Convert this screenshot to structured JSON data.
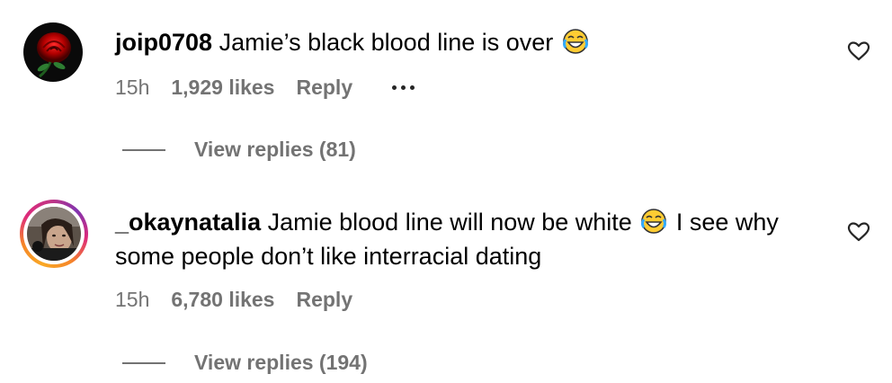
{
  "comments": [
    {
      "username": "joip0708",
      "text_before_emoji": "Jamie’s black blood line is over",
      "emoji_name": "face-with-tears-of-joy-icon",
      "text_after_emoji": "",
      "time": "15h",
      "likes": "1,929 likes",
      "reply_label": "Reply",
      "view_replies": "View replies (81)",
      "avatar_icon": "rose-avatar"
    },
    {
      "username": "_okaynatalia",
      "text_before_emoji": "Jamie blood line will now be white",
      "emoji_name": "face-with-tears-of-joy-icon",
      "text_after_emoji": "I see why some people don’t like interracial dating",
      "time": "15h",
      "likes": "6,780 likes",
      "reply_label": "Reply",
      "view_replies": "View replies (194)",
      "avatar_icon": "user-photo-avatar-with-story-ring"
    }
  ],
  "colors": {
    "secondary_text": "#737373",
    "primary_text": "#000000",
    "story_ring_start": "#f9a825",
    "story_ring_end": "#c13584"
  }
}
